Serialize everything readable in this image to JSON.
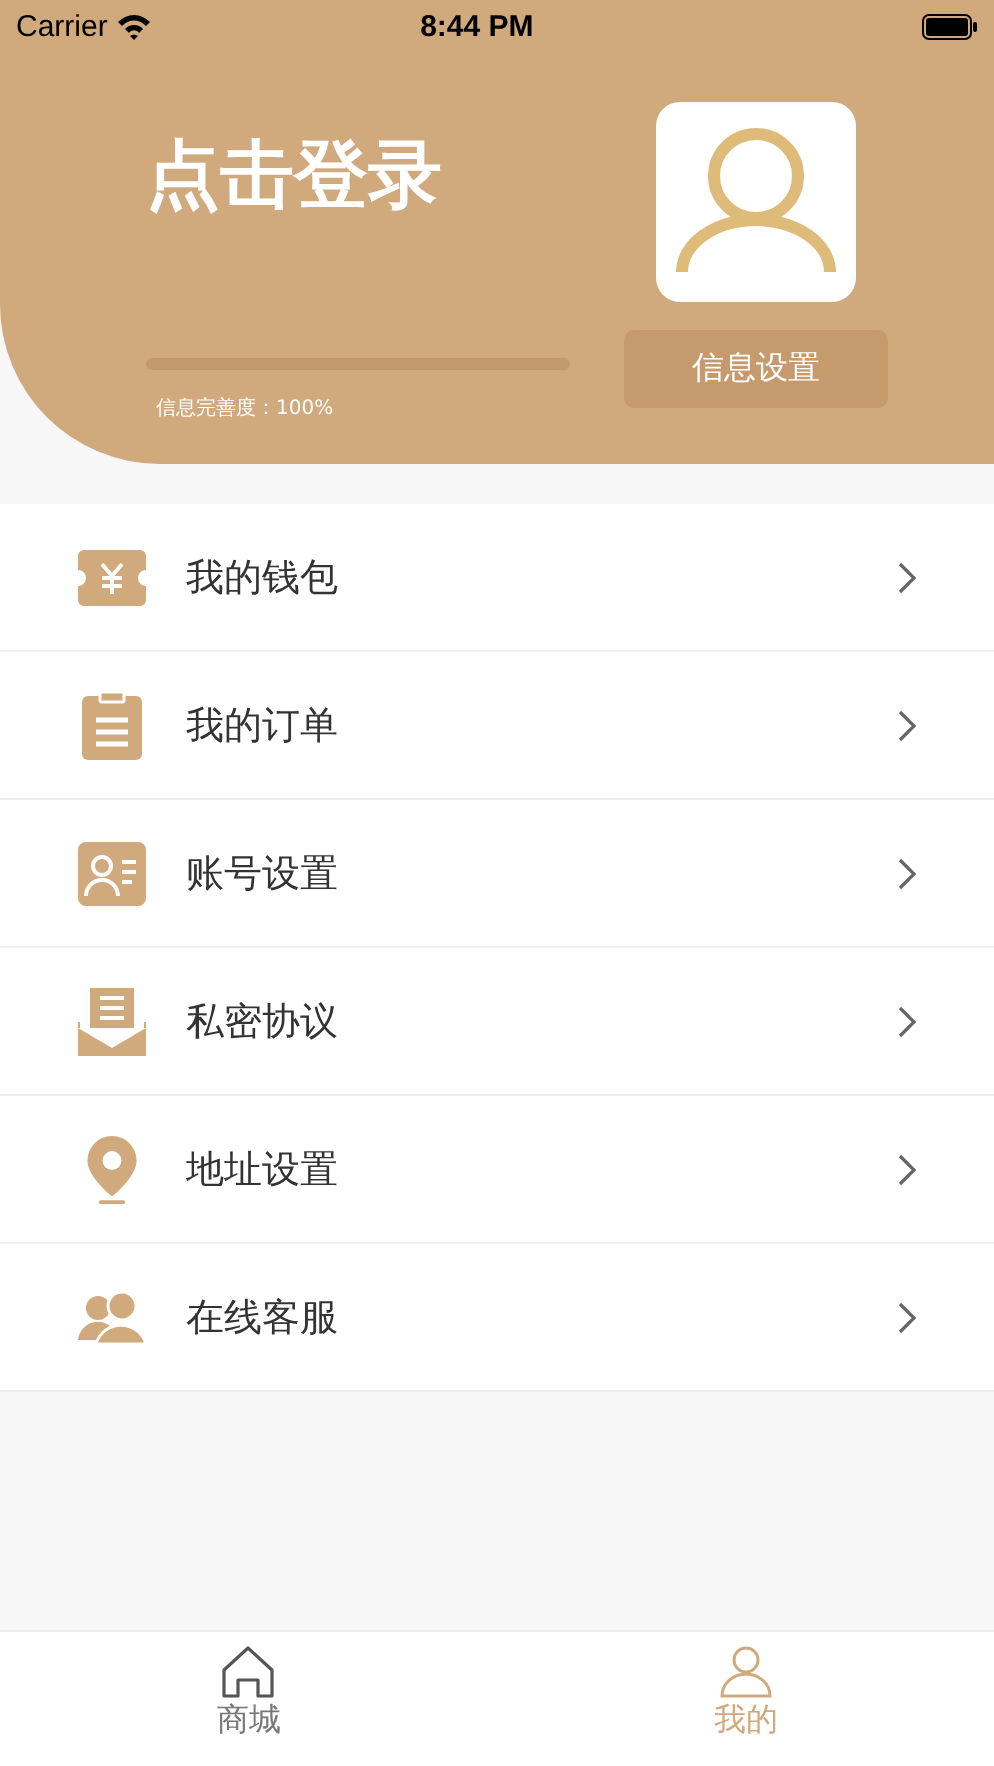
{
  "status_bar": {
    "carrier": "Carrier",
    "time": "8:44 PM"
  },
  "header": {
    "title": "点击登录",
    "progress": {
      "level": 1.0,
      "label": "信息完善度：100%"
    },
    "settings_button": "信息设置"
  },
  "menu": [
    {
      "kind": "wallet",
      "label": "我的钱包"
    },
    {
      "kind": "order",
      "label": "我的订单"
    },
    {
      "kind": "account",
      "label": "账号设置"
    },
    {
      "kind": "privacy",
      "label": "私密协议"
    },
    {
      "kind": "address",
      "label": "地址设置"
    },
    {
      "kind": "service",
      "label": "在线客服"
    }
  ],
  "tab_bar": [
    {
      "kind": "home",
      "label": "商城",
      "selected": false
    },
    {
      "kind": "profile",
      "label": "我的",
      "selected": true
    }
  ]
}
